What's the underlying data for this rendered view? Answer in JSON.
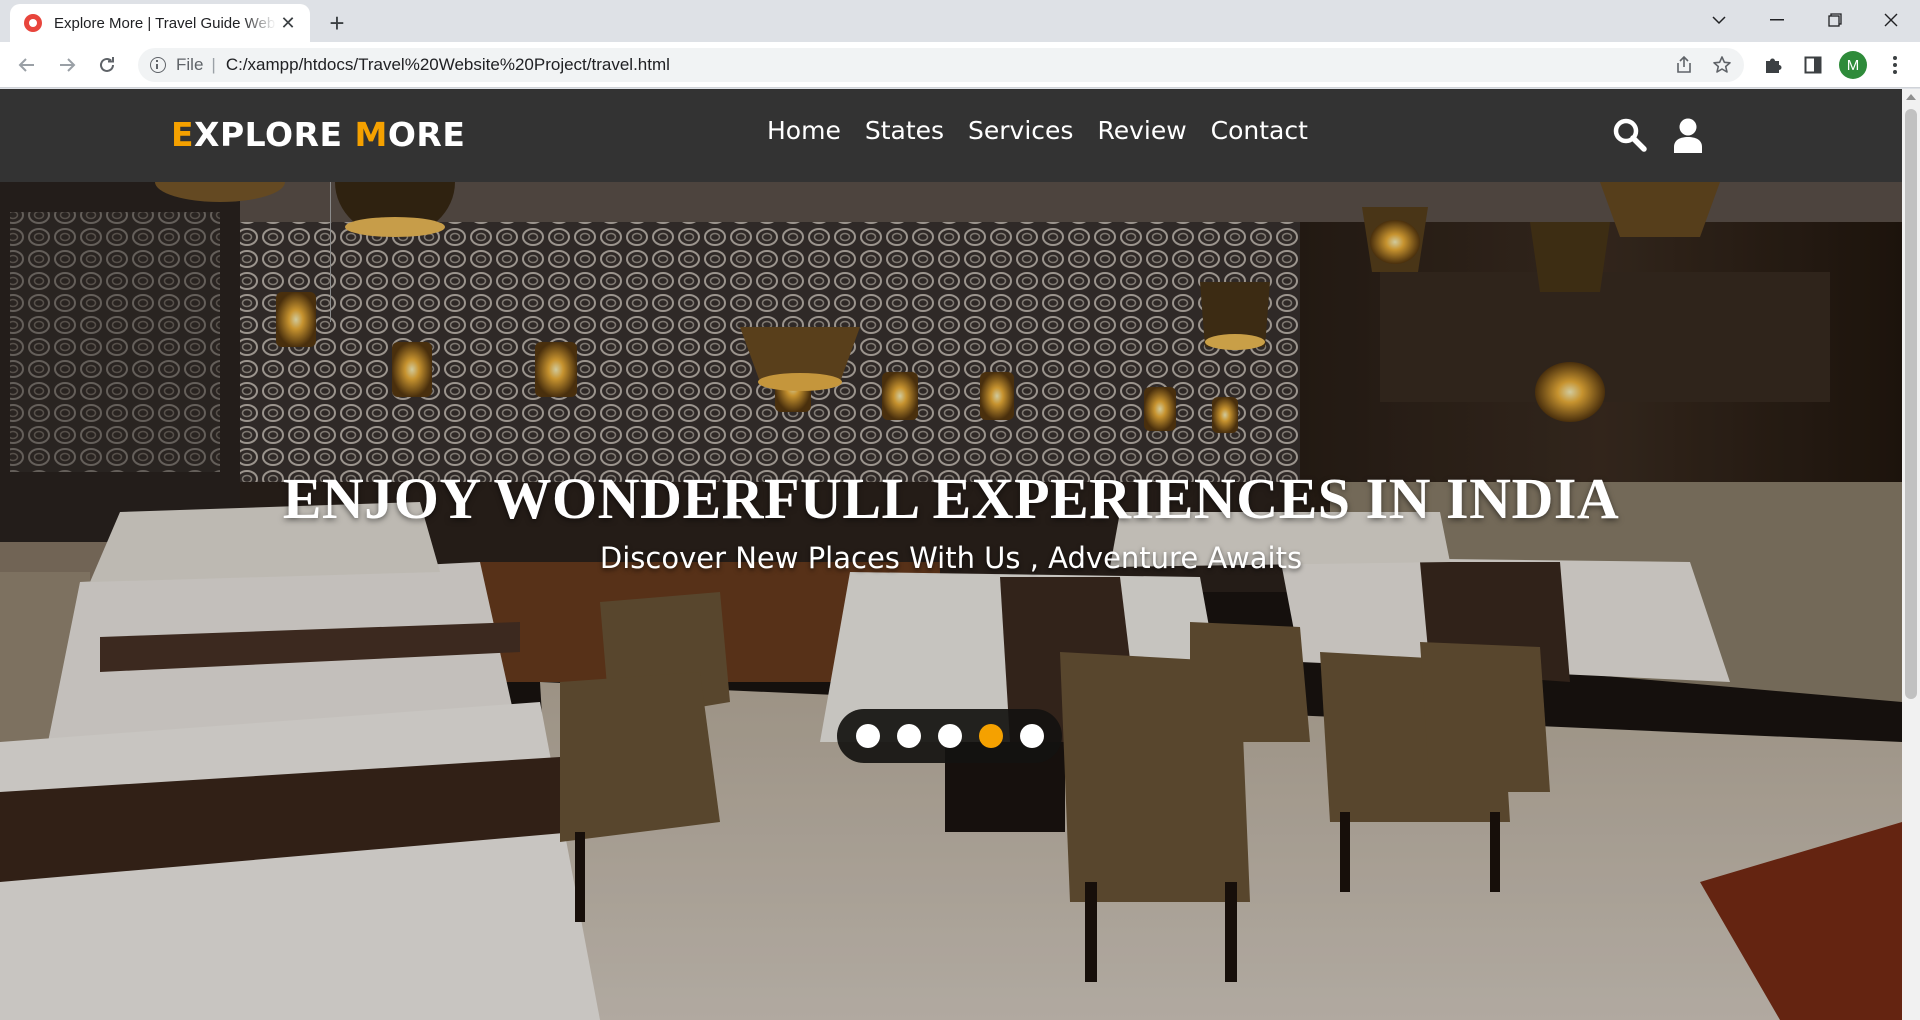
{
  "browser": {
    "tab_title": "Explore More | Travel Guide Website",
    "omnibox_scheme": "File",
    "omnibox_separator": "|",
    "url": "C:/xampp/htdocs/Travel%20Website%20Project/travel.html",
    "profile_initial": "M"
  },
  "site": {
    "logo_first_letter": "E",
    "logo_first_rest": "XPLORE ",
    "logo_second_letter": "M",
    "logo_second_rest": "ORE",
    "accent_color": "#f5a100",
    "nav": [
      "Home",
      "States",
      "Services",
      "Review",
      "Contact"
    ],
    "header_icons": [
      "search-icon",
      "user-icon"
    ]
  },
  "hero": {
    "title": "ENJOY WONDERFULL EXPERIENCES IN INDIA",
    "subtitle": "Discover New Places With Us , Adventure Awaits",
    "slides_count": 5,
    "active_slide": 4
  }
}
